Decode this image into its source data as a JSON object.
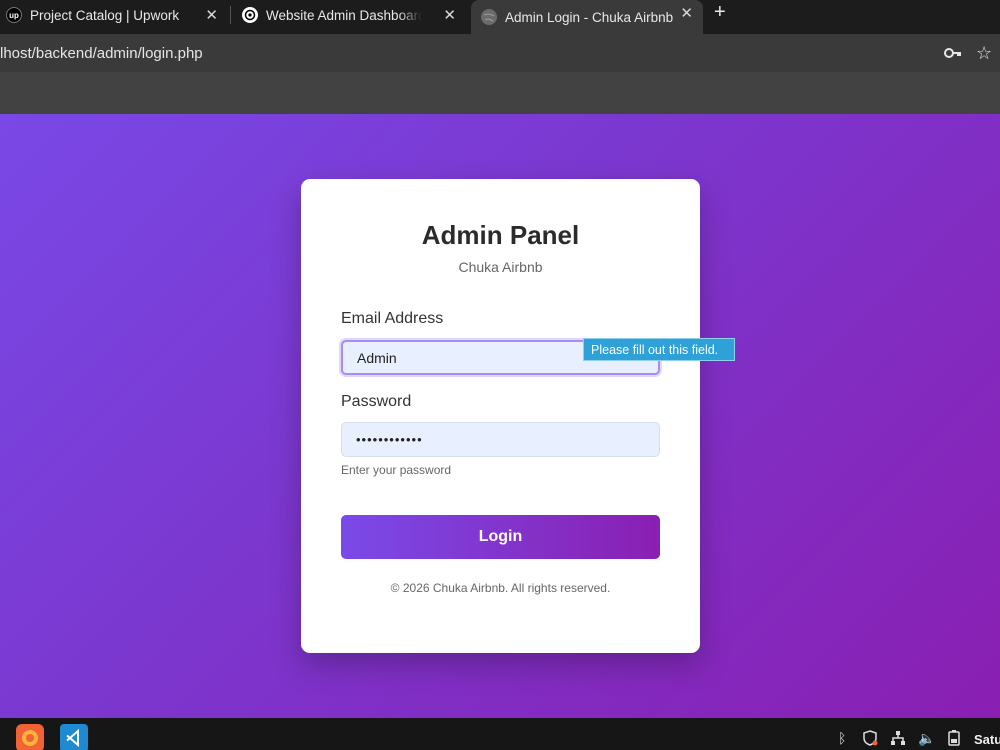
{
  "browser": {
    "tabs": [
      {
        "icon": "upwork-icon",
        "fav_text": "up",
        "title": "Project Catalog | Upwork"
      },
      {
        "icon": "openai-icon",
        "fav_text": "",
        "title": "Website Admin Dashboard S"
      },
      {
        "icon": "globe-icon",
        "fav_text": "",
        "title": "Admin Login - Chuka Airbnb"
      }
    ],
    "url": "lhost/backend/admin/login.php"
  },
  "login": {
    "heading": "Admin Panel",
    "subtitle": "Chuka Airbnb",
    "email_label": "Email Address",
    "email_value": "Admin",
    "password_label": "Password",
    "password_value": "••••••••••••",
    "password_hint": "Enter your password",
    "button_label": "Login",
    "footer": "© 2026 Chuka Airbnb. All rights reserved.",
    "validation_tooltip": "Please fill out this field."
  },
  "taskbar": {
    "apps": [
      "firefox-icon",
      "vscode-icon"
    ],
    "tray": [
      "bluetooth-icon",
      "shield-icon",
      "network-icon",
      "volume-icon",
      "battery-icon"
    ],
    "clock": "Satu"
  },
  "colors": {
    "gradient_start": "#7a48e6",
    "gradient_end": "#8a1fb2",
    "tooltip": "#2da1d8"
  }
}
